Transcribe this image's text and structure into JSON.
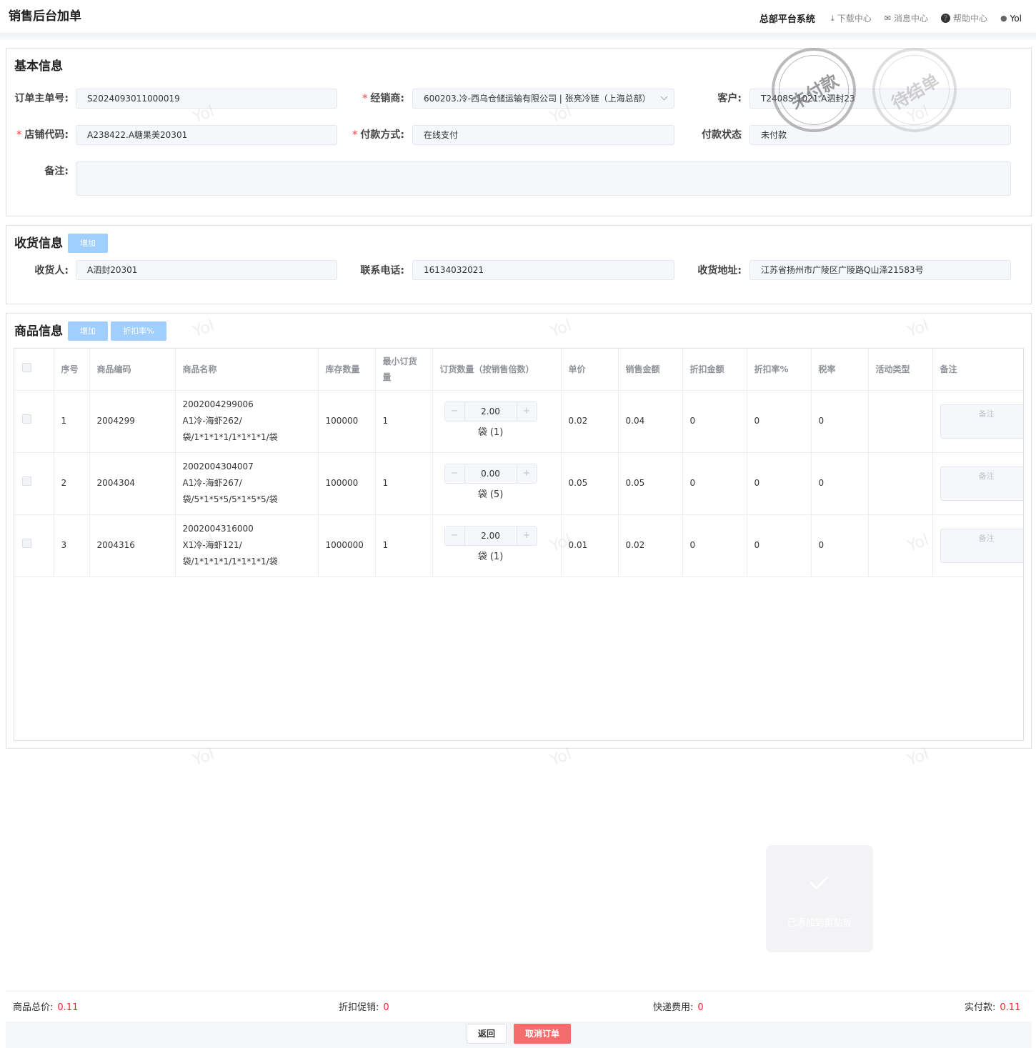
{
  "header": {
    "page_title": "销售后台加单",
    "system": "总部平台系统",
    "download": "下载中心",
    "messages": "消息中心",
    "help": "帮助中心",
    "user": "Yol"
  },
  "basic": {
    "title": "基本信息",
    "order_no_label": "订单主单号:",
    "order_no": "S2024093011000019",
    "dealer_label": "经销商:",
    "dealer": "600203.冷-西乌仓储运输有限公司 | 张亮冷链（上海总部）",
    "customer_label": "客户:",
    "customer": "T2408S-1021.A泗封23",
    "store_label": "店铺代码:",
    "store": "A238422.A糖果美20301",
    "pay_method_label": "付款方式:",
    "pay_method": "在线支付",
    "pay_status_label": "付款状态",
    "pay_status": "未付款",
    "remark_label": "备注:",
    "remark": ""
  },
  "stamps": {
    "unpaid": "未付款",
    "pending": "待结单"
  },
  "receiver": {
    "title": "收货信息",
    "add_label": "增加",
    "name_label": "收货人:",
    "name": "A泗封20301",
    "phone_label": "联系电话:",
    "phone": "16134032021",
    "address_label": "收货地址:",
    "address": "江苏省扬州市广陵区广陵路Q山泽21583号"
  },
  "goods": {
    "title": "商品信息",
    "add_label": "增加",
    "discount_label": "折扣率%",
    "columns": [
      "序号",
      "商品编码",
      "商品名称",
      "库存数量",
      "最小订货量",
      "订货数量（按销售倍数）",
      "单价",
      "销售金额",
      "折扣金额",
      "折扣率%",
      "税率",
      "活动类型",
      "备注"
    ],
    "remark_placeholder": "备注",
    "rows": [
      {
        "no": "1",
        "code": "2004299",
        "name_line1": "2002004299006",
        "name_line2": "A1冷-海虾262/袋/1*1*1*1/1*1*1*1/袋",
        "stock": "100000",
        "min_qty": "1",
        "qty": "2.00",
        "unit": "袋 (1)",
        "price": "0.02",
        "amount": "0.04",
        "disc_amt": "0",
        "disc_rate": "0",
        "tax": "0",
        "activity": ""
      },
      {
        "no": "2",
        "code": "2004304",
        "name_line1": "2002004304007",
        "name_line2": "A1冷-海虾267/袋/5*1*5*5/5*1*5*5/袋",
        "stock": "100000",
        "min_qty": "1",
        "qty": "0.00",
        "unit": "袋 (5)",
        "price": "0.05",
        "amount": "0.05",
        "disc_amt": "0",
        "disc_rate": "0",
        "tax": "0",
        "activity": ""
      },
      {
        "no": "3",
        "code": "2004316",
        "name_line1": "2002004316000",
        "name_line2": "X1冷-海虾121/袋/1*1*1*1/1*1*1*1/袋",
        "stock": "1000000",
        "min_qty": "1",
        "qty": "2.00",
        "unit": "袋 (1)",
        "price": "0.01",
        "amount": "0.02",
        "disc_amt": "0",
        "disc_rate": "0",
        "tax": "0",
        "activity": ""
      }
    ]
  },
  "summary": {
    "goods_total_label": "商品总价:",
    "goods_total": "0.11",
    "discount_label": "折扣促销:",
    "discount": "0",
    "shipping_label": "快递费用:",
    "shipping": "0",
    "paid_label": "实付款:",
    "paid": "0.11"
  },
  "actions": {
    "back": "返回",
    "cancel": "取消订单"
  },
  "toast": {
    "message": "已添加到剪贴板"
  },
  "watermark": "Yol",
  "colors": {
    "accent_red": "#f5222d",
    "cancel_button": "#f56c6c",
    "light_button": "#a0cfff"
  }
}
